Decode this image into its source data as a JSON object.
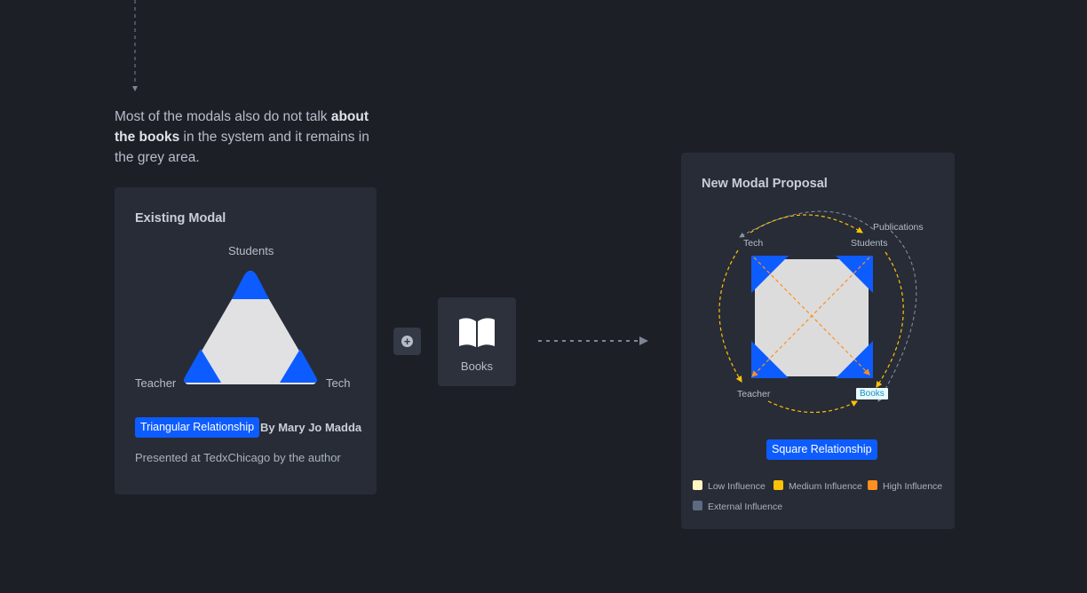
{
  "intro": {
    "part1": "Most of the modals also do not talk ",
    "bold": "about the books",
    "part2": " in the system and it remains in the grey area."
  },
  "existing": {
    "title": "Existing Modal",
    "vertex_top": "Students",
    "vertex_left": "Teacher",
    "vertex_right": "Tech",
    "tag": "Triangular Relationship",
    "author": "By Mary Jo Madda",
    "note": "Presented at TedxChicago by the author"
  },
  "plus": {
    "icon": "plus-circle-icon",
    "glyph": "+"
  },
  "books": {
    "icon": "open-book-icon",
    "label": "Books"
  },
  "proposal": {
    "title": "New Modal Proposal",
    "tech": "Tech",
    "students": "Students",
    "publications": "Publications",
    "teacher": "Teacher",
    "books": "Books",
    "tag": "Square Relationship"
  },
  "legend": [
    {
      "label": "Low Influence",
      "color": "#fff4c2"
    },
    {
      "label": "Medium Influence",
      "color": "#ffc107"
    },
    {
      "label": "High Influence",
      "color": "#ff8f1f"
    },
    {
      "label": "External Influence",
      "color": "#5e6a82"
    }
  ],
  "colors": {
    "background": "#1c1f26",
    "card": "#272c36",
    "accent_blue": "#0d5cff",
    "shape_fill": "#dcdcdc",
    "arrow_yellow": "#ffc107",
    "arrow_orange": "#ff8f1f",
    "arrow_grey": "#8c94a3"
  }
}
